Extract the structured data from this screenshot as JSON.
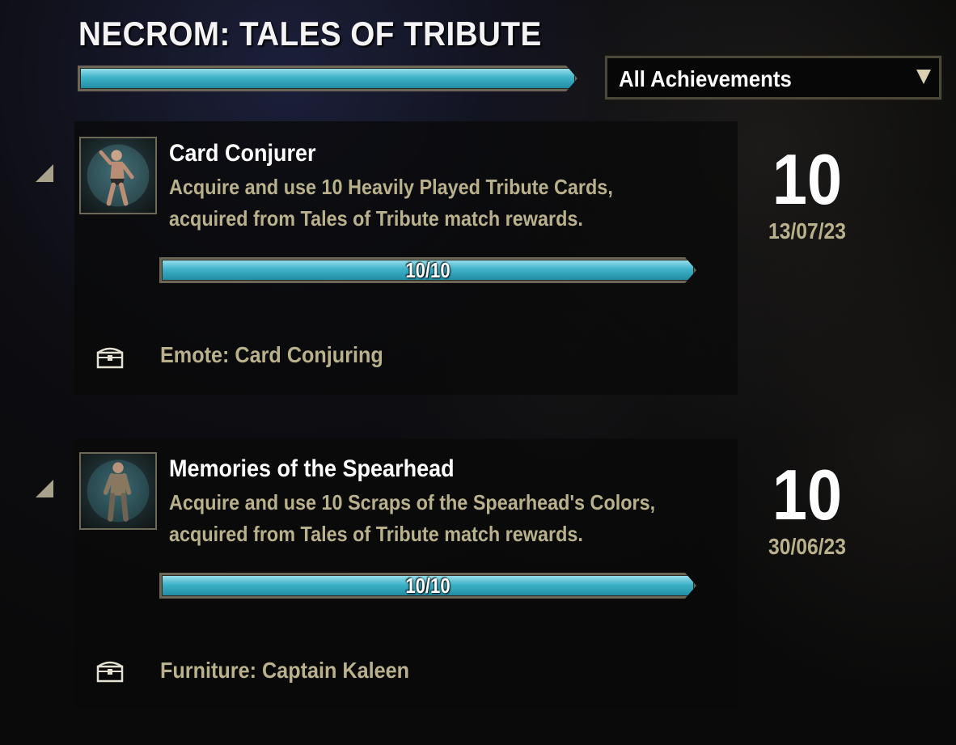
{
  "category": {
    "title": "NECROM: TALES OF TRIBUTE",
    "progress_fraction": 1.0
  },
  "filter": {
    "selected": "All Achievements",
    "icon": "chevron-down-icon"
  },
  "achievements": [
    {
      "name": "Card Conjurer",
      "description_line1": "Acquire and use 10 Heavily Played Tribute Cards,",
      "description_line2": "acquired from Tales of Tribute match rewards.",
      "progress_label": "10/10",
      "progress_fraction": 1.0,
      "points": "10",
      "date": "13/07/23",
      "reward_text": "Emote:  Card Conjuring",
      "reward_icon": "treasure-chest-icon",
      "icon": "dancing-figure-icon"
    },
    {
      "name": "Memories of the Spearhead",
      "description_line1": "Acquire and use 10 Scraps of the Spearhead's Colors,",
      "description_line2": "acquired from Tales of Tribute match rewards.",
      "progress_label": "10/10",
      "progress_fraction": 1.0,
      "points": "10",
      "date": "30/06/23",
      "reward_text": "Furniture:  Captain Kaleen",
      "reward_icon": "treasure-chest-icon",
      "icon": "captain-figure-icon"
    }
  ],
  "colors": {
    "bar_fill": "#3fb2c8",
    "title_text": "#ffffff",
    "description_text": "#b9b08c"
  }
}
